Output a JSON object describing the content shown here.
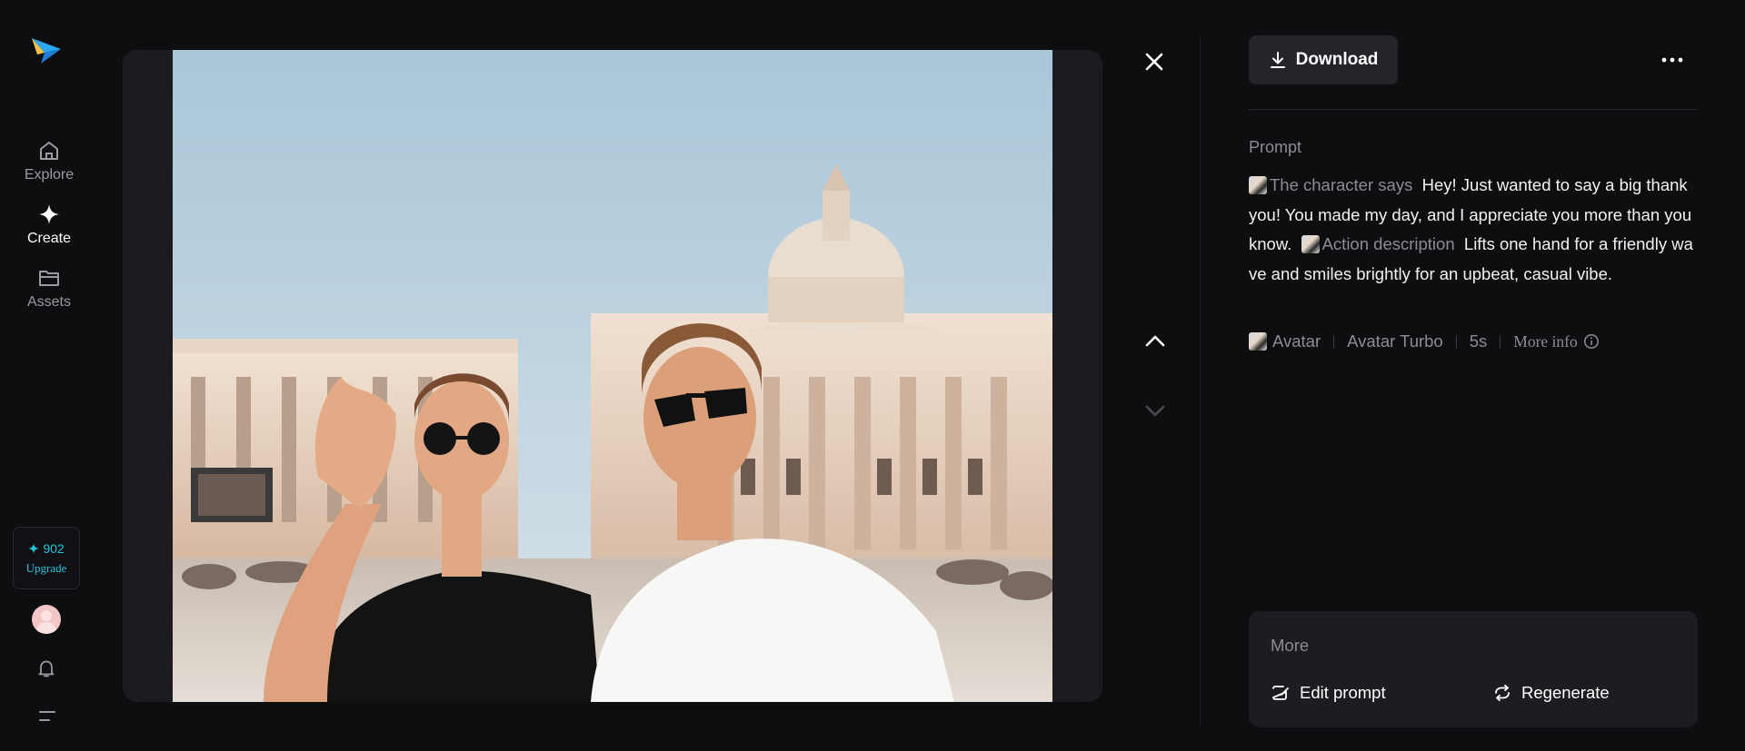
{
  "sidebar": {
    "items": [
      {
        "label": "Explore",
        "icon": "home-icon"
      },
      {
        "label": "Create",
        "icon": "sparkle-icon"
      },
      {
        "label": "Assets",
        "icon": "folder-icon"
      }
    ],
    "credits": {
      "count": "902",
      "upgrade_label": "Upgrade"
    }
  },
  "toolbar": {
    "download_label": "Download"
  },
  "prompt": {
    "title": "Prompt",
    "character_tag": "The character says",
    "character_text": "Hey! Just wanted to say a big thank you! You made my day, and I appreciate you more than you know.",
    "action_tag": "Action description",
    "action_text": "Lifts one hand for a friendly wave and smiles brightly for an upbeat, casual vibe."
  },
  "meta": {
    "type": "Avatar",
    "model": "Avatar Turbo",
    "duration": "5s",
    "more_info": "More info"
  },
  "more": {
    "title": "More",
    "edit_label": "Edit prompt",
    "regenerate_label": "Regenerate"
  },
  "colors": {
    "background": "#0e0e11",
    "accent": "#22c4dc",
    "panel": "#1c1c21"
  }
}
